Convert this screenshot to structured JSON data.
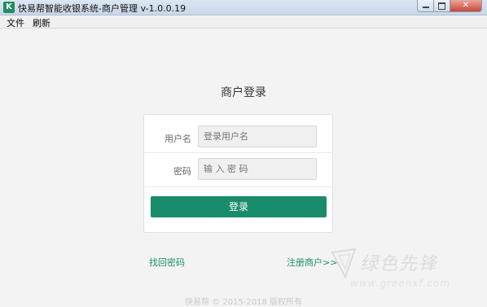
{
  "window": {
    "icon_letter": "K",
    "title": "快易帮智能收银系统-商户管理   v-1.0.0.19"
  },
  "menu": {
    "items": [
      "文件",
      "刷新"
    ]
  },
  "login": {
    "title": "商户登录",
    "username_label": "用户名",
    "username_placeholder": "登录用户名",
    "password_label": "密码",
    "password_placeholder": "输 入 密 码",
    "submit_label": "登录"
  },
  "links": {
    "forgot_password": "找回密码",
    "register": "注册商户>>"
  },
  "footer": {
    "copyright": "快易帮 © 2015-2018 版权所有"
  },
  "watermark": {
    "text": "绿色先锋",
    "url": "www.greenxf.com"
  },
  "colors": {
    "accent": "#198c6b",
    "link": "#1f8f6a"
  }
}
